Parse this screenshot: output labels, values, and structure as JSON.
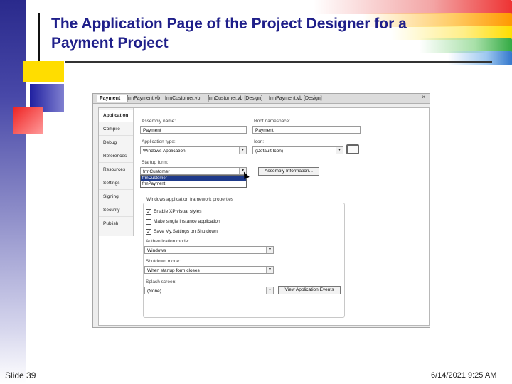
{
  "slide": {
    "title_line1": "The Application Page of the Project Designer for a",
    "title_line2": "Payment Project",
    "slide_number": "Slide 39",
    "date": "6/14/2021 9:25 AM"
  },
  "colors": {
    "title": "#1f1f8a",
    "accent_yellow": "#ffdd00",
    "accent_red": "#ee2222",
    "accent_blue": "#2020a0"
  },
  "window": {
    "tabs": [
      {
        "label": "Payment"
      },
      {
        "label": "frmPayment.vb"
      },
      {
        "label": "frmCustomer.vb"
      },
      {
        "label": "frmCustomer.vb [Design]"
      },
      {
        "label": "frmPayment.vb [Design]"
      }
    ],
    "close": "×"
  },
  "sidebar": {
    "items": [
      {
        "label": "Application"
      },
      {
        "label": "Compile"
      },
      {
        "label": "Debug"
      },
      {
        "label": "References"
      },
      {
        "label": "Resources"
      },
      {
        "label": "Settings"
      },
      {
        "label": "Signing"
      },
      {
        "label": "Security"
      },
      {
        "label": "Publish"
      }
    ]
  },
  "form": {
    "assembly_name_label": "Assembly name:",
    "assembly_name_value": "Payment",
    "root_namespace_label": "Root namespace:",
    "root_namespace_value": "Payment",
    "application_type_label": "Application type:",
    "application_type_value": "Windows Application",
    "icon_label": "Icon:",
    "icon_value": "(Default Icon)",
    "startup_form_label": "Startup form:",
    "startup_form_value": "frmCustomer",
    "assembly_info_button": "Assembly Information...",
    "dropdown_options": [
      "frmCustomer",
      "frmPayment"
    ],
    "group_label": "Windows application framework properties",
    "checkboxes": [
      {
        "label": "Enable XP visual styles",
        "checked": true
      },
      {
        "label": "Make single instance application",
        "checked": false
      },
      {
        "label": "Save My.Settings on Shutdown",
        "checked": true
      }
    ],
    "auth_mode_label": "Authentication mode:",
    "auth_mode_value": "Windows",
    "shutdown_mode_label": "Shutdown mode:",
    "shutdown_mode_value": "When startup form closes",
    "splash_label": "Splash screen:",
    "splash_value": "(None)",
    "view_events_button": "View Application Events"
  }
}
